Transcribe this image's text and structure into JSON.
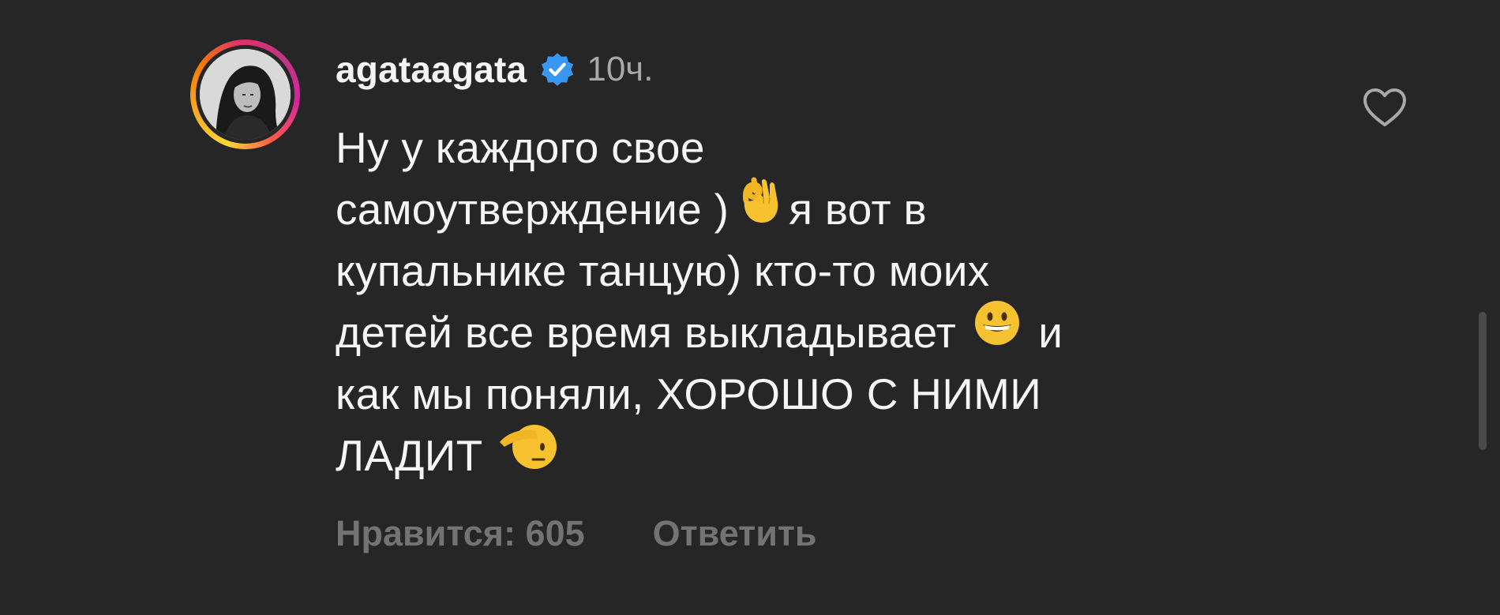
{
  "comment": {
    "author": {
      "username": "agataagata",
      "verified": true,
      "avatar_icon": "user-avatar-photo"
    },
    "timestamp": "10ч.",
    "text_lines": [
      "Ну у каждого свое",
      "самоутверждение )",
      "я вот в",
      "купальнике танцую) кто-то моих",
      "детей все время выкладывает",
      "и",
      "как мы поняли, ХОРОШО С НИМИ",
      "ЛАДИТ"
    ],
    "emojis": [
      "ok-hand-emoji",
      "grinning-face-emoji",
      "saluting-face-emoji"
    ],
    "likes_label": "Нравится: 605",
    "reply_label": "Ответить",
    "like_icon": "heart-outline-icon"
  },
  "colors": {
    "background": "#262626",
    "primary_text": "#f5f5f5",
    "secondary_text": "#a8a8a8",
    "action_text": "#737373",
    "verified_badge": "#3897f0"
  }
}
